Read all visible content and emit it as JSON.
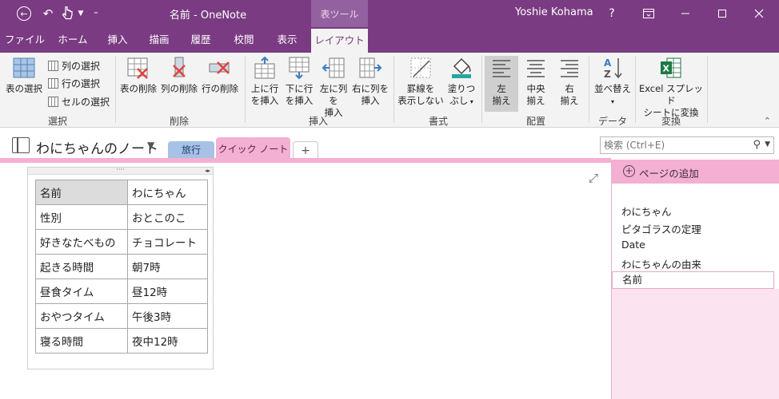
{
  "titlebar": {
    "doc_title": "名前 - OneNote",
    "context_tab": "表ツール",
    "user": "Yoshie Kohama",
    "help": "?",
    "qat_customize": "⁼"
  },
  "tabs": [
    "ファイル",
    "ホーム",
    "挿入",
    "描画",
    "履歴",
    "校閲",
    "表示",
    "レイアウト"
  ],
  "ribbon": {
    "select_group": {
      "label": "選択",
      "select_table": "表の選択",
      "select_col": "列の選択",
      "select_row": "行の選択",
      "select_cell": "セルの選択"
    },
    "delete_group": {
      "label": "削除",
      "delete_table": "表の削除",
      "delete_col": "列の削除",
      "delete_row": "行の削除"
    },
    "insert_group": {
      "label": "挿入",
      "above_1": "上に行",
      "above_2": "を挿入",
      "below_1": "下に行",
      "below_2": "を挿入",
      "left_1": "左に列を",
      "left_2": "挿入",
      "right_1": "右に列を",
      "right_2": "挿入"
    },
    "format_group": {
      "label": "書式",
      "borders_1": "罫線を",
      "borders_2": "表示しない",
      "shading_1": "塗りつ",
      "shading_2": "ぶし"
    },
    "align_group": {
      "label": "配置",
      "left_1": "左",
      "left_2": "揃え",
      "center_1": "中央",
      "center_2": "揃え",
      "right_1": "右",
      "right_2": "揃え"
    },
    "data_group": {
      "label": "データ",
      "sort": "並べ替え"
    },
    "convert_group": {
      "label": "変換",
      "excel_1": "Excel スプレッド",
      "excel_2": "シートに変換"
    }
  },
  "notebook": {
    "name": "わにちゃんのノート",
    "sections": [
      "旅行",
      "クイック ノート"
    ],
    "add_section": "+",
    "search_placeholder": "検索 (Ctrl+E)"
  },
  "table": {
    "rows": [
      [
        "名前",
        "わにちゃん"
      ],
      [
        "性別",
        "おとこのこ"
      ],
      [
        "好きなたべもの",
        "チョコレート"
      ],
      [
        "起きる時間",
        "朝7時"
      ],
      [
        "昼食タイム",
        "昼12時"
      ],
      [
        "おやつタイム",
        "午後3時"
      ],
      [
        "寝る時間",
        "夜中12時"
      ]
    ]
  },
  "pages": {
    "add_label": "ページの追加",
    "items": [
      "わにちゃん",
      "ピタゴラスの定理",
      "Date",
      "わにちゃんの由来",
      "名前"
    ]
  },
  "colors": {
    "brand": "#7a3b82",
    "section_quick": "#f4b0d2",
    "section_travel": "#a7c2e4"
  }
}
